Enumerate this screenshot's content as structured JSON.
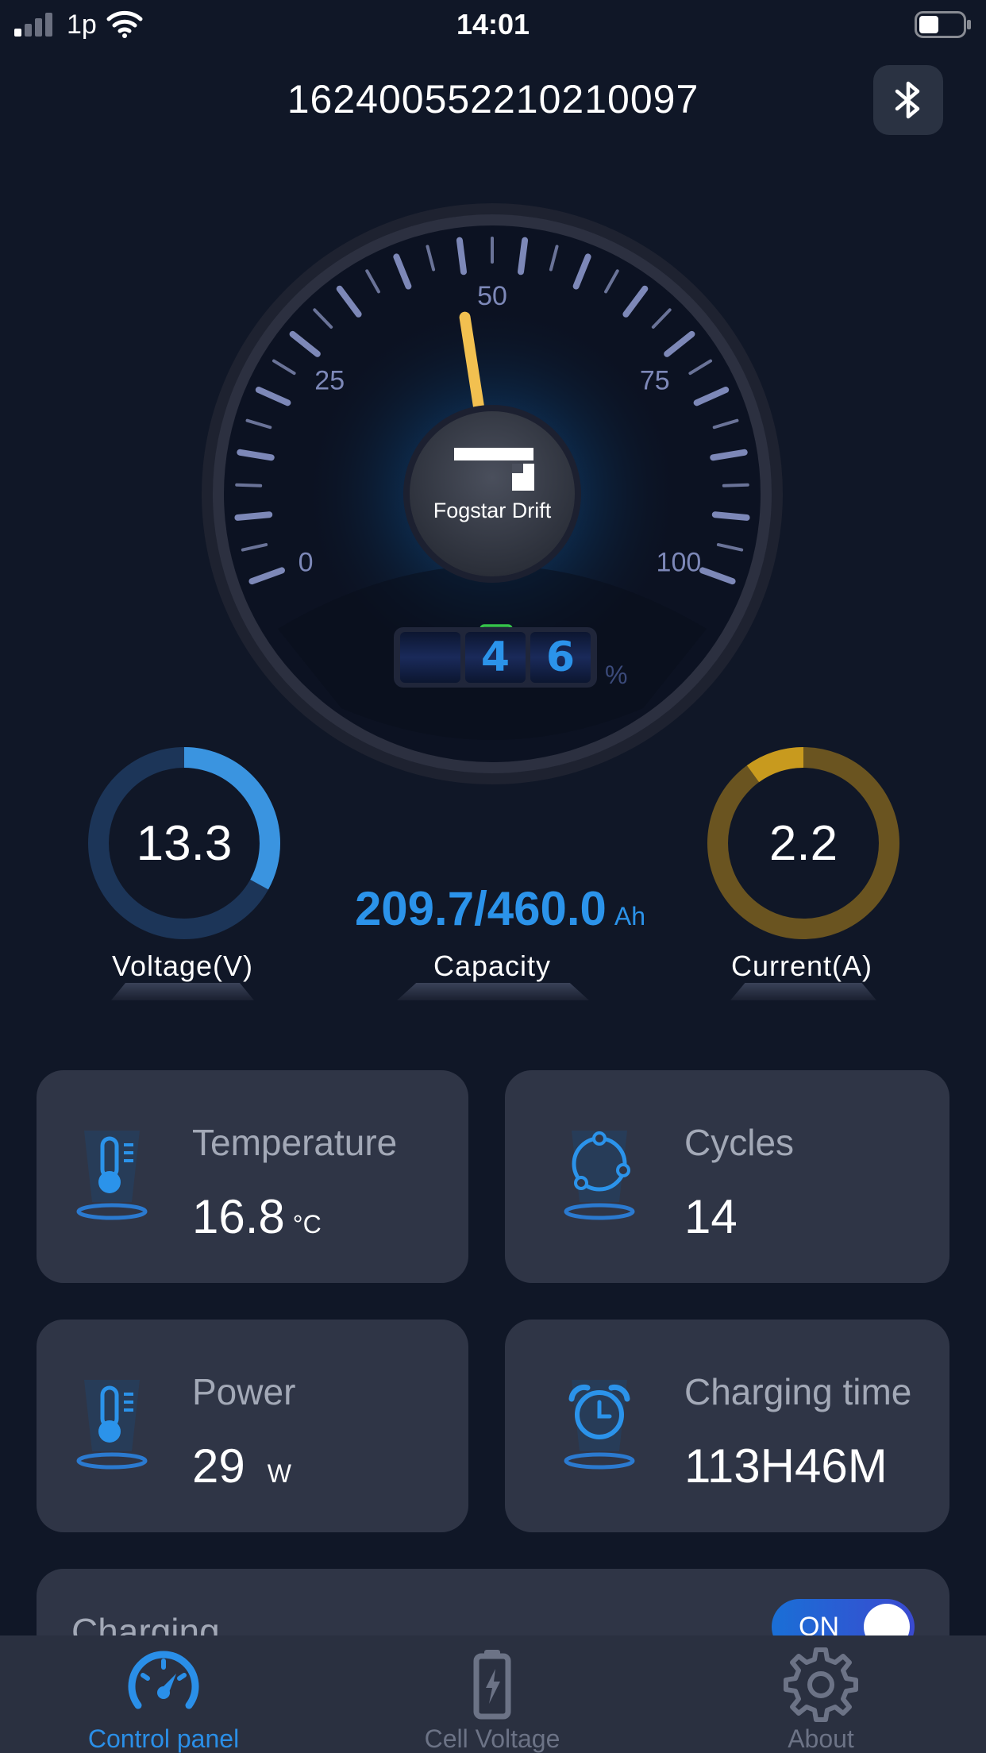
{
  "status_bar": {
    "carrier": "1p",
    "time": "14:01"
  },
  "header": {
    "device_id": "16240055221021009​7"
  },
  "gauge": {
    "brand": "Fogstar Drift",
    "ticks": [
      "0",
      "25",
      "50",
      "75",
      "100"
    ],
    "soc_percent": 46,
    "soc_digits": [
      "",
      "4",
      "6"
    ],
    "unit": "%"
  },
  "voltage": {
    "value": "13.3",
    "label": "Voltage(V)",
    "ring_fraction": 0.33
  },
  "capacity": {
    "value": "209.7/460.0",
    "unit": "Ah",
    "label": "Capacity"
  },
  "current": {
    "value": "2.2",
    "label": "Current(A)",
    "ring_fraction": 0.1
  },
  "cards": {
    "temperature": {
      "title": "Temperature",
      "value": "16.8",
      "unit": "°C"
    },
    "cycles": {
      "title": "Cycles",
      "value": "14"
    },
    "power": {
      "title": "Power",
      "value": "29",
      "unit": "W"
    },
    "charging_time": {
      "title": "Charging time",
      "value": "113H46M"
    },
    "charging": {
      "title": "Charging",
      "toggle": "ON"
    }
  },
  "tabs": [
    {
      "label": "Control panel",
      "active": true
    },
    {
      "label": "Cell Voltage",
      "active": false
    },
    {
      "label": "About",
      "active": false
    }
  ],
  "colors": {
    "accent": "#2b93ea",
    "gold": "#d4a020",
    "background": "#101727",
    "card": "#2f3546"
  }
}
